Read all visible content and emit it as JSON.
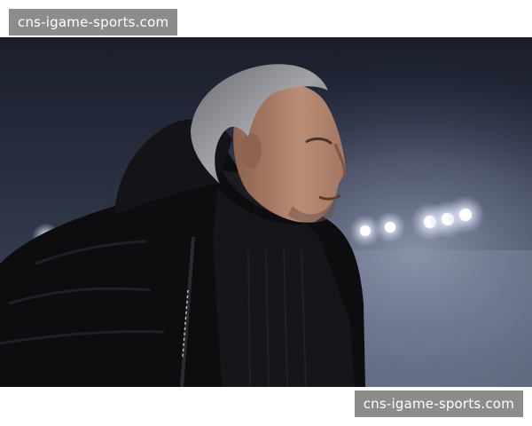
{
  "watermarks": {
    "top_text": "cns-igame-sports.com",
    "bottom_text": "cns-igame-sports.com"
  },
  "photo": {
    "subject": "man-in-black-puffer-jacket-under-stadium-lights",
    "colors": {
      "sky_top": "#1a1e2c",
      "sky_mid": "#3a4356",
      "fog": "#8f98b2",
      "jacket": "#0d0d10",
      "skin": "#b88a72",
      "hair": "#8e9094",
      "light": "#ffffff"
    }
  }
}
